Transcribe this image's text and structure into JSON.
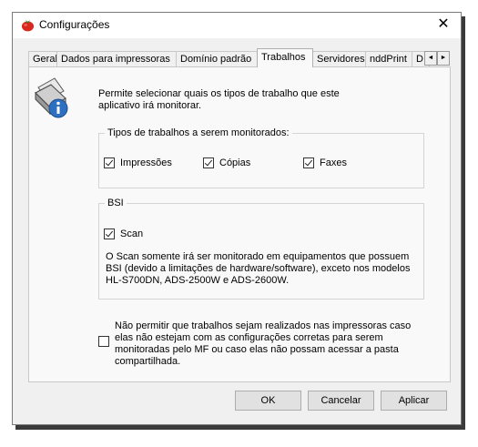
{
  "window": {
    "title": "Configurações",
    "close_glyph": "✕"
  },
  "tabs": [
    {
      "label": "Geral"
    },
    {
      "label": "Dados para impressoras"
    },
    {
      "label": "Domínio padrão"
    },
    {
      "label": "Trabalhos",
      "active": true
    },
    {
      "label": "Servidores"
    },
    {
      "label": "nddPrint"
    },
    {
      "label": "D"
    }
  ],
  "tab_scroll": {
    "left": "◄",
    "right": "►"
  },
  "trabalhos": {
    "description": "Permite selecionar quais os tipos de trabalho que este aplicativo irá monitorar.",
    "job_types": {
      "legend": "Tipos de trabalhos a serem monitorados:",
      "items": [
        {
          "label": "Impressões",
          "checked": true
        },
        {
          "label": "Cópias",
          "checked": true
        },
        {
          "label": "Faxes",
          "checked": true
        }
      ]
    },
    "bsi": {
      "legend": "BSI",
      "scan": {
        "label": "Scan",
        "checked": true
      },
      "note": "O Scan somente irá ser monitorado em equipamentos que possuem BSI (devido a limitações de hardware/software), exceto nos modelos HL-S700DN, ADS-2500W e ADS-2600W."
    },
    "block_option": {
      "label": "Não permitir que trabalhos sejam realizados nas impressoras caso elas não estejam com as configurações corretas para serem monitoradas pelo MF ou caso elas não possam acessar a pasta compartilhada.",
      "checked": false
    }
  },
  "buttons": {
    "ok": "OK",
    "cancel": "Cancelar",
    "apply": "Aplicar"
  },
  "icons": {
    "app": "tomato-app-icon",
    "info": "printer-info-icon",
    "close": "close-icon"
  }
}
